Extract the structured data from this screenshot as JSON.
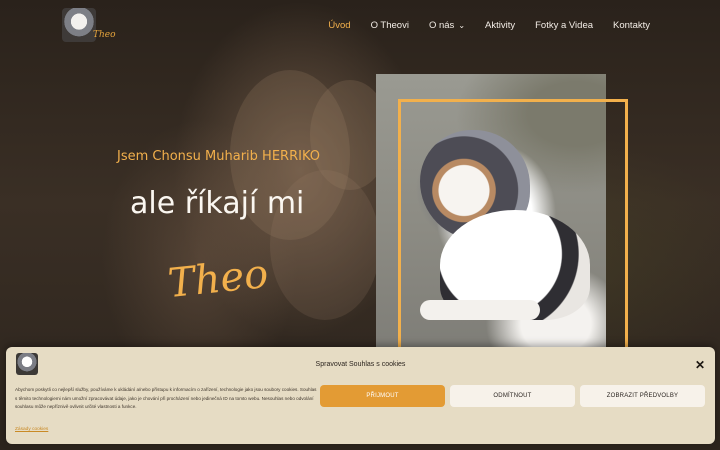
{
  "header": {
    "logo_text": "Theo",
    "nav": [
      {
        "label": "Úvod",
        "active": true
      },
      {
        "label": "O Theovi",
        "active": false
      },
      {
        "label": "O nás",
        "active": false,
        "dropdown": true
      },
      {
        "label": "Aktivity",
        "active": false
      },
      {
        "label": "Fotky a Videa",
        "active": false
      },
      {
        "label": "Kontakty",
        "active": false
      }
    ]
  },
  "hero": {
    "subtitle": "Jsem Chonsu Muharib HERRIKO",
    "main": "ale říkají mi",
    "script": "Theo"
  },
  "cookie": {
    "title": "Spravovat Souhlas s cookies",
    "text": "Abychom poskytli co nejlepší služby, používáme k ukládání a/nebo přístupu k informacím o zařízení, technologie jako jsou soubory cookies. Souhlas s těmito technologiemi nám umožní zpracovávat údaje, jako je chování při procházení nebo jedinečná ID na tomto webu. Nesouhlas nebo odvolání souhlasu může nepříznivě ovlivnit určité vlastnosti a funkce.",
    "link": "Zásady cookies",
    "accept": "PŘIJMOUT",
    "deny": "ODMÍTNOUT",
    "preferences": "ZOBRAZIT PŘEDVOLBY"
  },
  "colors": {
    "accent": "#f2b04c",
    "button_accept": "#e39b34",
    "banner": "#e6dcc4"
  }
}
